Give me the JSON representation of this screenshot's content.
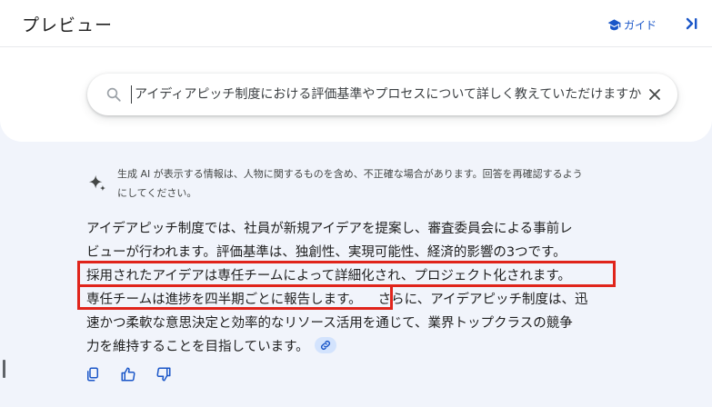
{
  "header": {
    "title": "プレビュー",
    "guide_label": "ガイド"
  },
  "search": {
    "value": "アイディアピッチ制度における評価基準やプロセスについて詳しく教えていただけますか"
  },
  "disclaimer": {
    "line1": "生成 AI が表示する情報は、人物に関するものを含め、不正確な場合があります。回答を再確認するよう",
    "line2": "にしてください。"
  },
  "answer": {
    "lines": [
      "アイデアピッチ制度では、社員が新規アイデアを提案し、審査委員会による事前レ",
      "ビューが行われます。評価基準は、独創性、実現可能性、経済的影響の3つです。",
      "採用されたアイデアは専任チームによって詳細化され、プロジェクト化されます。",
      "専任チームは進捗を四半期ごとに報告します。",
      "さらに、アイデアピッチ制度は、迅",
      "速かつ柔軟な意思決定と効率的なリソース活用を通じて、業界トップクラスの競争",
      "力を維持することを目指しています。"
    ]
  },
  "icons": {
    "guide": "graduation-cap-icon",
    "collapse": "collapse-panel-icon",
    "search": "search-icon",
    "clear": "close-icon",
    "sparkle": "sparkle-icon",
    "link": "link-icon",
    "copy": "copy-icon",
    "like": "thumbs-up-icon",
    "dislike": "thumbs-down-icon"
  },
  "colors": {
    "accent": "#1a56c8",
    "highlight_border": "#e0241b",
    "background": "#f1f4fb",
    "chip": "#d3e3fd"
  }
}
